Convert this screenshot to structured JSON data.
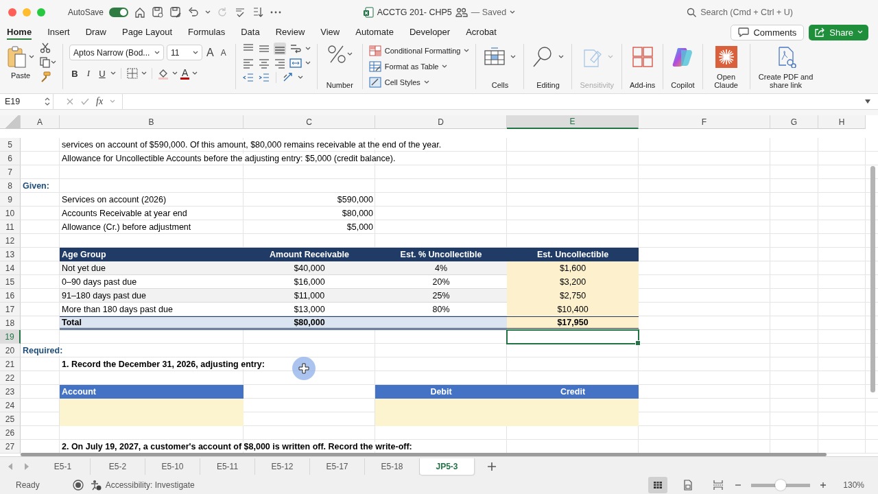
{
  "window": {
    "title": "ACCTG 201- CHP5",
    "status": "— Saved",
    "autosave": {
      "label": "AutoSave",
      "on": true
    },
    "search": {
      "placeholder": "Search (Cmd + Ctrl + U)"
    }
  },
  "ribbon_tabs": [
    {
      "label": "Home",
      "selected": true
    },
    {
      "label": "Insert",
      "selected": false
    },
    {
      "label": "Draw",
      "selected": false
    },
    {
      "label": "Page Layout",
      "selected": false
    },
    {
      "label": "Formulas",
      "selected": false
    },
    {
      "label": "Data",
      "selected": false
    },
    {
      "label": "Review",
      "selected": false
    },
    {
      "label": "View",
      "selected": false
    },
    {
      "label": "Automate",
      "selected": false
    },
    {
      "label": "Developer",
      "selected": false
    },
    {
      "label": "Acrobat",
      "selected": false
    }
  ],
  "comments_button": "Comments",
  "share_button": "Share",
  "ribbon": {
    "paste": "Paste",
    "font": {
      "name": "Aptos Narrow (Bod...",
      "size": "11",
      "grow": "A",
      "shrink": "A",
      "bold": "B",
      "italic": "I",
      "underline": "U",
      "font_color": "A"
    },
    "number": "Number",
    "styles": [
      {
        "kind": "conditional",
        "label": "Conditional Formatting"
      },
      {
        "kind": "table",
        "label": "Format as Table"
      },
      {
        "kind": "cell_styles",
        "label": "Cell Styles"
      }
    ],
    "groups": [
      {
        "kind": "cells",
        "label": "Cells",
        "disabled": false
      },
      {
        "kind": "editing",
        "label": "Editing",
        "disabled": false
      },
      {
        "kind": "sensitivity",
        "label": "Sensitivity",
        "disabled": true
      },
      {
        "kind": "addins",
        "label": "Add-ins",
        "disabled": false
      },
      {
        "kind": "copilot",
        "label": "Copilot",
        "disabled": false
      },
      {
        "kind": "claude",
        "label": "Open Claude",
        "disabled": false
      },
      {
        "kind": "pdf",
        "label": "Create PDF and share link",
        "disabled": false
      }
    ]
  },
  "formula_bar": {
    "name_box": "E19",
    "fx": "fx"
  },
  "sheet": {
    "columns": [
      {
        "label": "A",
        "selected": false
      },
      {
        "label": "B",
        "selected": false
      },
      {
        "label": "C",
        "selected": false
      },
      {
        "label": "D",
        "selected": false
      },
      {
        "label": "E",
        "selected": true
      },
      {
        "label": "F",
        "selected": false
      },
      {
        "label": "G",
        "selected": false
      },
      {
        "label": "H",
        "selected": false
      }
    ],
    "rows": [
      {
        "number": "5",
        "selected": false,
        "cells": {
          "B": {
            "kind": "text",
            "text": "services on account of $590,000. Of this amount, $80,000 remains receivable at the end of the year."
          }
        }
      },
      {
        "number": "6",
        "selected": false,
        "cells": {
          "B": {
            "kind": "text",
            "text": "Allowance for Uncollectible Accounts before the adjusting entry: $5,000 (credit balance)."
          }
        }
      },
      {
        "number": "7",
        "selected": false,
        "cells": {}
      },
      {
        "number": "8",
        "selected": false,
        "cells": {
          "A": {
            "kind": "heading",
            "text": "Given:"
          }
        }
      },
      {
        "number": "9",
        "selected": false,
        "cells": {
          "B": {
            "kind": "text",
            "text": "Services on account (2026)"
          },
          "C": {
            "kind": "amount",
            "text": "$590,000"
          }
        }
      },
      {
        "number": "10",
        "selected": false,
        "cells": {
          "B": {
            "kind": "text",
            "text": "Accounts Receivable at year end"
          },
          "C": {
            "kind": "amount",
            "text": "$80,000"
          }
        }
      },
      {
        "number": "11",
        "selected": false,
        "cells": {
          "B": {
            "kind": "text",
            "text": "Allowance (Cr.) before adjustment"
          },
          "C": {
            "kind": "amount",
            "text": "$5,000"
          }
        }
      },
      {
        "number": "12",
        "selected": false,
        "cells": {}
      },
      {
        "number": "13",
        "selected": false,
        "cells": {
          "B": {
            "kind": "th",
            "text": "Age Group"
          },
          "C": {
            "kind": "th_c",
            "text": "Amount Receivable"
          },
          "D": {
            "kind": "th_c",
            "text": "Est. % Uncollectible"
          },
          "E": {
            "kind": "th_c",
            "text": "Est. Uncollectible"
          }
        }
      },
      {
        "number": "14",
        "selected": false,
        "banded": true,
        "cells": {
          "B": {
            "kind": "td",
            "text": "Not yet due"
          },
          "C": {
            "kind": "td_c",
            "text": "$40,000"
          },
          "D": {
            "kind": "td_c",
            "text": "4%"
          },
          "E": {
            "kind": "est",
            "text": "$1,600"
          }
        }
      },
      {
        "number": "15",
        "selected": false,
        "banded": false,
        "cells": {
          "B": {
            "kind": "td",
            "text": "0–90 days past due"
          },
          "C": {
            "kind": "td_c",
            "text": "$16,000"
          },
          "D": {
            "kind": "td_c",
            "text": "20%"
          },
          "E": {
            "kind": "est",
            "text": "$3,200"
          }
        }
      },
      {
        "number": "16",
        "selected": false,
        "banded": true,
        "cells": {
          "B": {
            "kind": "td",
            "text": "91–180 days past due"
          },
          "C": {
            "kind": "td_c",
            "text": "$11,000"
          },
          "D": {
            "kind": "td_c",
            "text": "25%"
          },
          "E": {
            "kind": "est",
            "text": "$2,750"
          }
        }
      },
      {
        "number": "17",
        "selected": false,
        "banded": false,
        "cells": {
          "B": {
            "kind": "td",
            "text": "More than 180 days past due"
          },
          "C": {
            "kind": "td_c",
            "text": "$13,000"
          },
          "D": {
            "kind": "td_c",
            "text": "80%"
          },
          "E": {
            "kind": "est",
            "text": "$10,400"
          }
        }
      },
      {
        "number": "18",
        "selected": false,
        "cells": {
          "B": {
            "kind": "total",
            "text": "Total"
          },
          "C": {
            "kind": "total_c",
            "text": "$80,000"
          },
          "D": {
            "kind": "total"
          },
          "E": {
            "kind": "total_est",
            "text": "$17,950"
          }
        }
      },
      {
        "number": "19",
        "selected": true,
        "cells": {
          "E": {
            "kind": "text",
            "selected": true
          }
        }
      },
      {
        "number": "20",
        "selected": false,
        "cells": {
          "A": {
            "kind": "heading",
            "text": "Required:"
          }
        }
      },
      {
        "number": "21",
        "selected": false,
        "cells": {
          "B": {
            "kind": "bold",
            "text": "1. Record the December 31, 2026, adjusting entry:"
          }
        }
      },
      {
        "number": "22",
        "selected": false,
        "cells": {}
      },
      {
        "number": "23",
        "selected": false,
        "cells": {
          "B": {
            "kind": "jh",
            "text": "Account"
          },
          "D": {
            "kind": "jh_c",
            "text": "Debit"
          },
          "E": {
            "kind": "jh_c",
            "text": "Credit"
          }
        }
      },
      {
        "number": "24",
        "selected": false,
        "cells": {
          "B": {
            "kind": "input"
          },
          "D": {
            "kind": "input"
          },
          "E": {
            "kind": "input"
          }
        }
      },
      {
        "number": "25",
        "selected": false,
        "cells": {
          "B": {
            "kind": "input"
          },
          "D": {
            "kind": "input"
          },
          "E": {
            "kind": "input"
          }
        }
      },
      {
        "number": "26",
        "selected": false,
        "cells": {}
      },
      {
        "number": "27",
        "selected": false,
        "cells": {
          "B": {
            "kind": "bold",
            "text": "2. On July 19, 2027, a customer's account of $8,000 is written off. Record the write-off:"
          }
        }
      }
    ]
  },
  "sheet_tabs": [
    {
      "label": "E5-1",
      "selected": false
    },
    {
      "label": "E5-2",
      "selected": false
    },
    {
      "label": "E5-10",
      "selected": false
    },
    {
      "label": "E5-11",
      "selected": false
    },
    {
      "label": "E5-12",
      "selected": false
    },
    {
      "label": "E5-17",
      "selected": false
    },
    {
      "label": "E5-18",
      "selected": false
    },
    {
      "label": "JP5-3",
      "selected": true
    }
  ],
  "status_bar": {
    "state": "Ready",
    "accessibility": "Accessibility: Investigate",
    "views": [
      {
        "kind": "normal",
        "selected": true
      },
      {
        "kind": "page_layout",
        "selected": false
      },
      {
        "kind": "page_break",
        "selected": false
      }
    ],
    "zoom_slider": {
      "level": 0.5
    },
    "zoom": "130%"
  }
}
